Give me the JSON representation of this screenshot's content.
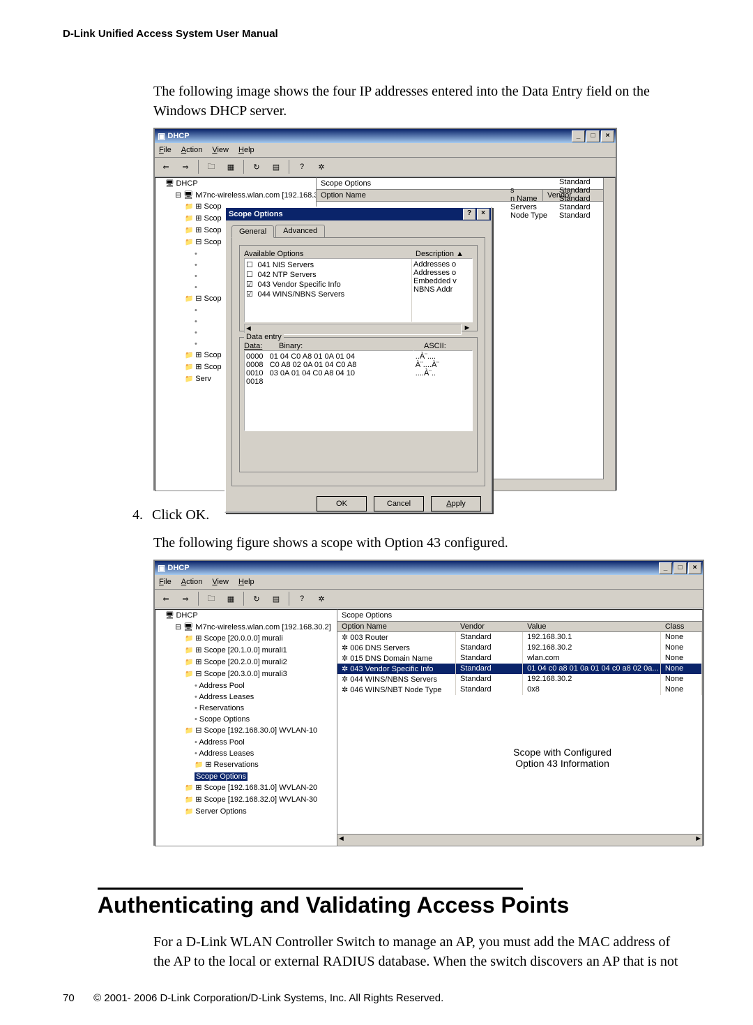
{
  "running_head": "D-Link Unified Access System User Manual",
  "para1": "The following image shows the four IP addresses entered into the Data Entry field on the Windows DHCP server.",
  "step4_num": "4.",
  "step4_text": "Click OK.",
  "para2": "The following figure shows a scope with Option 43 configured.",
  "section_title": "Authenticating and Validating Access Points",
  "para3": "For a D-Link WLAN Controller Switch to manage an AP, you must add the MAC address of the AP to the local or external RADIUS database. When the switch discovers an AP that is not",
  "page_number": "70",
  "copyright": "© 2001- 2006 D-Link Corporation/D-Link Systems, Inc. All Rights Reserved.",
  "win1": {
    "title": "DHCP",
    "menus": {
      "file": "File",
      "action": "Action",
      "view": "View",
      "help": "Help"
    },
    "tree_root": "DHCP",
    "tree_server": "lvl7nc-wireless.wlan.com [192.168.30.2]",
    "tree_scope_prefix": "Scop",
    "tree_serv": "Serv",
    "right_header": {
      "title": "Scope Options",
      "col_option": "Option Name",
      "col_vendor": "Vendor"
    },
    "behind_rows": [
      {
        "name": "",
        "vendor": "Standard"
      },
      {
        "name": "s",
        "vendor": "Standard"
      },
      {
        "name": "n Name",
        "vendor": "Standard"
      },
      {
        "name": "Servers",
        "vendor": "Standard"
      },
      {
        "name": "Node Type",
        "vendor": "Standard"
      }
    ],
    "dialog": {
      "title": "Scope Options",
      "tab_general": "General",
      "tab_advanced": "Advanced",
      "available_label": "Available Options",
      "desc_label": "Description",
      "options": [
        {
          "checked": false,
          "label": "041 NIS Servers",
          "desc": "Addresses o"
        },
        {
          "checked": false,
          "label": "042 NTP Servers",
          "desc": "Addresses o"
        },
        {
          "checked": true,
          "label": "043 Vendor Specific Info",
          "desc": "Embedded v"
        },
        {
          "checked": true,
          "label": "044 WINS/NBNS Servers",
          "desc": "NBNS Addr"
        }
      ],
      "data_entry_label": "Data entry",
      "col_data": "Data:",
      "col_binary": "Binary:",
      "col_ascii": "ASCII:",
      "hex_lines": "0000   01 04 C0 A8 01 0A 01 04\n0008   C0 A8 02 0A 01 04 C0 A8\n0010   03 0A 01 04 C0 A8 04 10\n0018",
      "ascii_lines": "..À¨....\nÀ¨....À¨\n....À¨..\n",
      "btn_ok": "OK",
      "btn_cancel": "Cancel",
      "btn_apply": "Apply"
    }
  },
  "win2": {
    "title": "DHCP",
    "menus": {
      "file": "File",
      "action": "Action",
      "view": "View",
      "help": "Help"
    },
    "tree_root": "DHCP",
    "tree_server": "lvl7nc-wireless.wlan.com [192.168.30.2]",
    "tree_scopes": [
      "Scope [20.0.0.0] murali",
      "Scope [20.1.0.0] murali1",
      "Scope [20.2.0.0] murali2",
      "Scope [20.3.0.0] murali3"
    ],
    "tree_children": [
      "Address Pool",
      "Address Leases",
      "Reservations",
      "Scope Options"
    ],
    "tree_scope_sel": "Scope [192.168.30.0] WVLAN-10",
    "tree_children_sel": [
      "Address Pool",
      "Address Leases",
      "Reservations",
      "Scope Options"
    ],
    "tree_more": [
      "Scope [192.168.31.0] WVLAN-20",
      "Scope [192.168.32.0] WVLAN-30",
      "Server Options"
    ],
    "list_title": "Scope Options",
    "columns": {
      "name": "Option Name",
      "vendor": "Vendor",
      "value": "Value",
      "class": "Class"
    },
    "rows": [
      {
        "name": "003 Router",
        "vendor": "Standard",
        "value": "192.168.30.1",
        "class": "None"
      },
      {
        "name": "006 DNS Servers",
        "vendor": "Standard",
        "value": "192.168.30.2",
        "class": "None"
      },
      {
        "name": "015 DNS Domain Name",
        "vendor": "Standard",
        "value": "wlan.com",
        "class": "None"
      },
      {
        "name": "043 Vendor Specific Info",
        "vendor": "Standard",
        "value": "01 04 c0 a8 01 0a 01 04 c0 a8 02 0a...",
        "class": "None",
        "selected": true
      },
      {
        "name": "044 WINS/NBNS Servers",
        "vendor": "Standard",
        "value": "192.168.30.2",
        "class": "None"
      },
      {
        "name": "046 WINS/NBT Node Type",
        "vendor": "Standard",
        "value": "0x8",
        "class": "None"
      }
    ],
    "annotation_l1": "Scope with Configured",
    "annotation_l2": "Option 43 Information"
  }
}
